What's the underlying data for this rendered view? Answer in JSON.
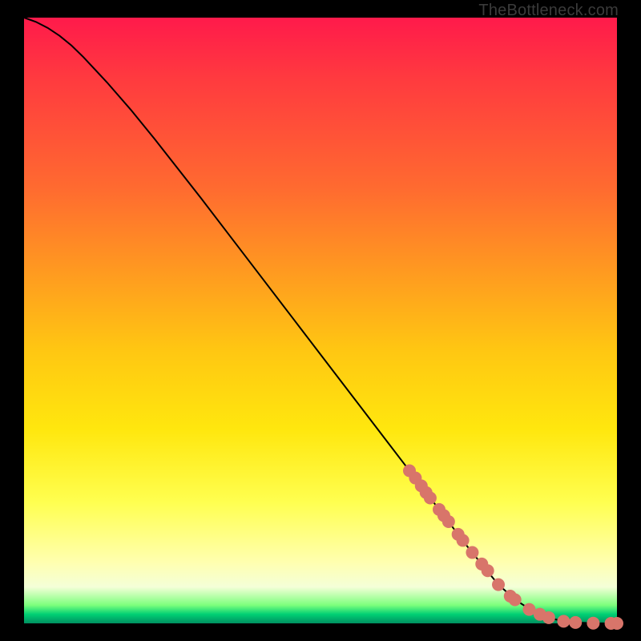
{
  "attribution": "TheBottleneck.com",
  "colors": {
    "curve": "#000000",
    "marker_fill": "#d8756a",
    "marker_stroke": "#c05a4f"
  },
  "chart_data": {
    "type": "line",
    "title": "",
    "xlabel": "",
    "ylabel": "",
    "xlim": [
      0,
      100
    ],
    "ylim": [
      0,
      100
    ],
    "series": [
      {
        "name": "curve",
        "x": [
          0,
          2,
          4,
          6,
          8,
          10,
          14,
          18,
          22,
          26,
          30,
          35,
          40,
          45,
          50,
          55,
          60,
          65,
          70,
          75,
          80,
          83,
          86,
          89,
          91,
          93,
          95,
          97,
          99,
          100
        ],
        "y": [
          100,
          99.3,
          98.3,
          97.0,
          95.4,
          93.5,
          89.3,
          84.8,
          80.0,
          75.0,
          70.0,
          63.6,
          57.2,
          50.8,
          44.4,
          38.0,
          31.6,
          25.2,
          18.8,
          12.4,
          6.4,
          3.8,
          1.9,
          0.8,
          0.35,
          0.15,
          0.06,
          0.02,
          0.005,
          0.0
        ]
      }
    ],
    "markers": {
      "name": "highlight-points",
      "x": [
        65.0,
        66.0,
        67.0,
        67.8,
        68.5,
        70.0,
        70.8,
        71.6,
        73.2,
        74.0,
        75.6,
        77.2,
        78.2,
        80.0,
        82.0,
        82.8,
        85.2,
        87.0,
        88.5,
        91.0,
        93.0,
        96.0,
        99.0,
        100.0
      ],
      "y": [
        25.2,
        24.0,
        22.7,
        21.6,
        20.7,
        18.8,
        17.8,
        16.8,
        14.7,
        13.7,
        11.7,
        9.8,
        8.7,
        6.4,
        4.5,
        3.9,
        2.3,
        1.5,
        0.95,
        0.35,
        0.15,
        0.04,
        0.006,
        0.0
      ]
    }
  }
}
